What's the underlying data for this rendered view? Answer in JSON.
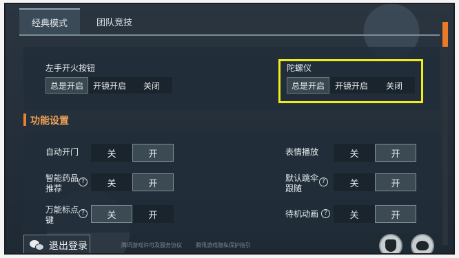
{
  "tabs": {
    "classic": "经典模式",
    "team": "团队竞技"
  },
  "fire_button": {
    "label": "左手开火按钮",
    "options": [
      "总是开启",
      "开镜开启",
      "关闭"
    ],
    "selected": "总是开启"
  },
  "gyroscope": {
    "label": "陀螺仪",
    "options": [
      "总是开启",
      "开镜开启",
      "关闭"
    ],
    "selected": "总是开启"
  },
  "section": {
    "title": "功能设置"
  },
  "settings": {
    "auto_door": {
      "label": "自动开门",
      "off": "关",
      "on": "开"
    },
    "smart_med_l1": "智能药品",
    "smart_med_l2": "推荐",
    "smart_med": {
      "off": "关",
      "on": "开"
    },
    "marker_l1": "万能标点",
    "marker_l2": "键",
    "marker": {
      "off": "关",
      "on": "开"
    },
    "emote": {
      "label": "表情播放",
      "off": "关",
      "on": "开"
    },
    "parachute_l1": "默认跳伞",
    "parachute_l2": "跟随",
    "parachute": {
      "off": "关",
      "on": "开"
    },
    "idle_anim": {
      "label": "待机动画",
      "off": "关",
      "on": "开"
    }
  },
  "help_glyph": "?",
  "footer": {
    "logout": "退出登录",
    "link1": "腾讯游戏许可及服务协议",
    "link2": "腾讯游戏隐私保护指引"
  },
  "icons": [
    "wechat-icon",
    "help-icon",
    "shield-icon",
    "headset-icon"
  ],
  "colors": {
    "accent": "#e8832d",
    "highlight": "#f2ec1c"
  }
}
